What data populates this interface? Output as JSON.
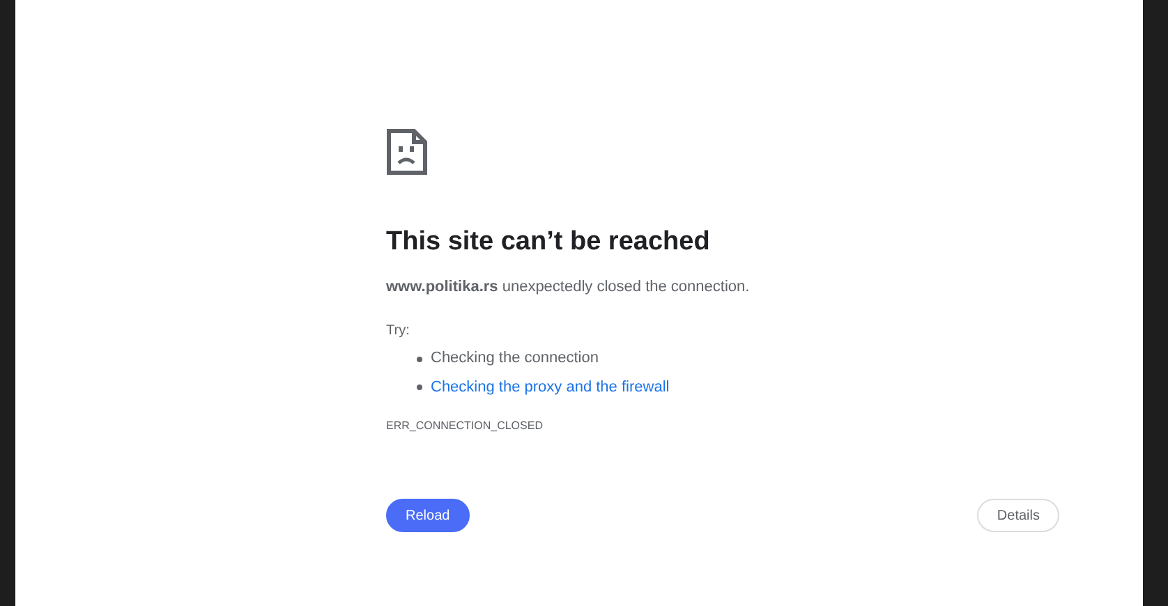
{
  "heading": "This site can’t be reached",
  "message": "**www.politika.rs** unexpectedly closed the connection.",
  "try_label": "Try:",
  "suggestions": [
    {
      "text": "Checking the connection",
      "link": false
    },
    {
      "text": "Checking the proxy and the firewall",
      "link": true
    }
  ],
  "error_code": "ERR_CONNECTION_CLOSED",
  "buttons": [
    {
      "label": "Reload",
      "kind": "primary"
    },
    {
      "label": "Details",
      "kind": "secondary"
    }
  ]
}
